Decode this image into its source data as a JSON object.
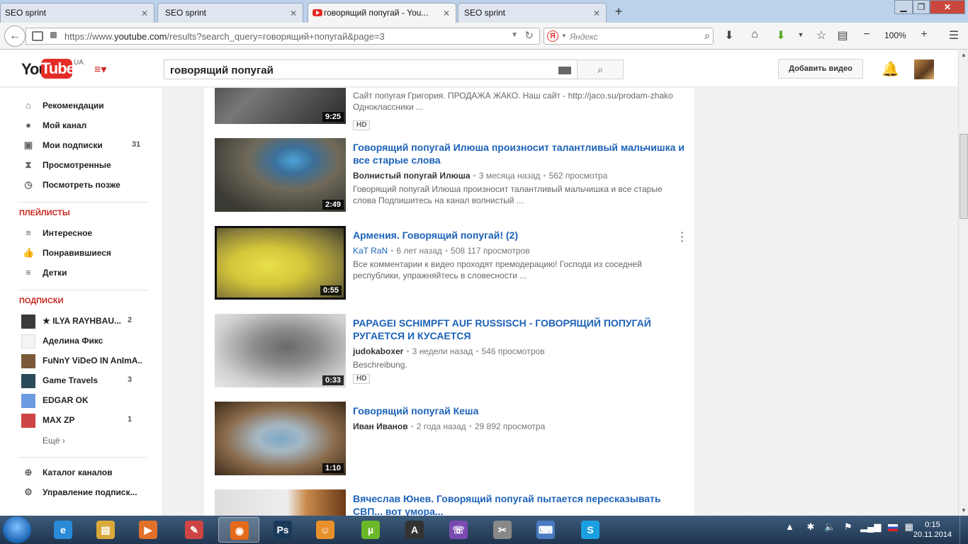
{
  "browser": {
    "tabs": [
      {
        "label": "SEO sprint",
        "active": false
      },
      {
        "label": "SEO sprint",
        "active": false
      },
      {
        "label": "говорящий попугай - You...",
        "active": true
      },
      {
        "label": "SEO sprint",
        "active": false
      }
    ],
    "new_tab_label": "+",
    "url_prefix": "https://www.",
    "url_domain": "youtube.com",
    "url_rest": "/results?search_query=говорящий+попугай&page=3",
    "search_placeholder": "Яндекс",
    "search_engine_glyph": "Я",
    "zoom": "100%"
  },
  "youtube": {
    "logo_you": "You",
    "logo_tube": "Tube",
    "region": "UA",
    "search_query": "говорящий попугай",
    "upload_label": "Добавить видео"
  },
  "sidebar": {
    "main_items": [
      {
        "label": "Рекомендации",
        "icon": "home-icon",
        "glyph": "⌂"
      },
      {
        "label": "Мой канал",
        "icon": "user-icon",
        "glyph": "●"
      },
      {
        "label": "Мои подписки",
        "icon": "subscriptions-icon",
        "glyph": "▣",
        "count": "31"
      },
      {
        "label": "Просмотренные",
        "icon": "history-icon",
        "glyph": "⧗"
      },
      {
        "label": "Посмотреть позже",
        "icon": "clock-icon",
        "glyph": "◷"
      }
    ],
    "playlists_heading": "ПЛЕЙЛИСТЫ",
    "playlists": [
      {
        "label": "Интересное",
        "icon": "list-icon",
        "glyph": "≡"
      },
      {
        "label": "Понравившиеся",
        "icon": "thumb-up-icon",
        "glyph": "👍"
      },
      {
        "label": "Детки",
        "icon": "list-icon",
        "glyph": "≡"
      }
    ],
    "subscriptions_heading": "ПОДПИСКИ",
    "subscriptions": [
      {
        "label": "★ ILYA RAYHBAU...",
        "count": "2",
        "color": "#3a3a3a"
      },
      {
        "label": "Аделина Фикс",
        "count": "",
        "color": "#f4f4f4"
      },
      {
        "label": "FuNnY ViDeO IN AnImA...",
        "count": "",
        "color": "#7a5a38"
      },
      {
        "label": "Game Travels",
        "count": "3",
        "color": "#2b4a5a"
      },
      {
        "label": "EDGAR OK",
        "count": "",
        "color": "#6d9be2"
      },
      {
        "label": "MAX ZP",
        "count": "1",
        "color": "#c44"
      }
    ],
    "more_label": "Ещё ›",
    "footer_items": [
      {
        "label": "Каталог каналов",
        "icon": "plus-circle-icon",
        "glyph": "⊕"
      },
      {
        "label": "Управление подписк...",
        "icon": "gear-icon",
        "glyph": "⚙"
      }
    ]
  },
  "results": [
    {
      "title": "",
      "channel": "",
      "age": "",
      "views": "",
      "desc": [
        "Сайт попугая Григория. ПРОДАЖА ЖАКО. Наш сайт - http://jaco.su/prodam-zhako",
        "Одноклассники ..."
      ],
      "duration": "9:25",
      "hd": "HD",
      "thumb_bg": "linear-gradient(135deg,#3a3a3a,#777 40%,#2a2a2a)"
    },
    {
      "title": "Говорящий попугай Илюша произносит талантливый мальчишка и все старые слова",
      "channel": "Волнистый попугай Илюша",
      "age": "3 месяца назад",
      "views": "562 просмотра",
      "desc": [
        "Говорящий попугай Илюша произносит талантливый мальчишка и все старые",
        "слова Подпишитесь на канал волнистый ..."
      ],
      "duration": "2:49",
      "hd": "",
      "thumb_bg": "radial-gradient(ellipse at 60% 30%,#4da3d8 0,#3b6f9a 18%,#6f6a5a 40%,#3c3a34 80%)"
    },
    {
      "title": "Армения. Говорящий попугай! (2)",
      "channel": "KaT RaN",
      "age": "6 лет назад",
      "views": "508 117 просмотров",
      "desc": [
        "Все комментарии к видео проходят премодерацию! Господа из соседней",
        "республики, упражняйтесь в словесности ..."
      ],
      "duration": "0:55",
      "hd": "",
      "thumb_bg": "radial-gradient(ellipse at 40% 55%,#e8e04a 0,#d4c53a 35%,#8a7f3a 70%,#3a3a2a 100%)"
    },
    {
      "title": "PAPAGEI SCHIMPFT AUF RUSSISCH - ГОВОРЯЩИЙ ПОПУГАЙ РУГАЕТСЯ И КУСАЕТСЯ",
      "channel": "judokaboxer",
      "age": "3 недели назад",
      "views": "546 просмотров",
      "desc": [
        "Beschreibung."
      ],
      "duration": "0:33",
      "hd": "HD",
      "thumb_bg": "radial-gradient(ellipse at 55% 45%,#6a6a6a 0,#8a8a8a 30%,#cfcfcf 70%,#e8e8e8 100%)"
    },
    {
      "title": "Говорящий попугай Кеша",
      "channel": "Иван Иванов",
      "age": "2 года назад",
      "views": "29 892 просмотра",
      "desc": [],
      "duration": "1:10",
      "hd": "",
      "thumb_bg": "radial-gradient(ellipse at 50% 50%,#7ea8c8 0,#a6b8c4 25%,#8a6a4a 60%,#3a2a1a 100%)"
    },
    {
      "title": "Вячеслав Юнев. Говорящий попугай пытается пересказывать СВП... вот умора...",
      "channel": "",
      "age": "",
      "views": "",
      "desc": [],
      "duration": "",
      "hd": "",
      "thumb_bg": "linear-gradient(90deg,#ddd 0,#eee 55%,#c9894a 70%,#6a3a1a 100%)"
    }
  ],
  "taskbar": {
    "apps": [
      {
        "name": "ie-icon",
        "glyph": "e",
        "color": "#2a8ad8"
      },
      {
        "name": "explorer-icon",
        "glyph": "▤",
        "color": "#d9a93a"
      },
      {
        "name": "media-player-icon",
        "glyph": "▶",
        "color": "#e0702a"
      },
      {
        "name": "paint-icon",
        "glyph": "✎",
        "color": "#c44"
      },
      {
        "name": "firefox-icon",
        "glyph": "◉",
        "color": "#e66a1a"
      },
      {
        "name": "photoshop-icon",
        "glyph": "Ps",
        "color": "#1b3a5a"
      },
      {
        "name": "ok-icon",
        "glyph": "☺",
        "color": "#e8902a"
      },
      {
        "name": "utorrent-icon",
        "glyph": "µ",
        "color": "#6ab82a"
      },
      {
        "name": "aimp-icon",
        "glyph": "A",
        "color": "#333"
      },
      {
        "name": "viber-icon",
        "glyph": "☏",
        "color": "#7a4ab0"
      },
      {
        "name": "tools-icon",
        "glyph": "✂",
        "color": "#888"
      },
      {
        "name": "keyboard-icon",
        "glyph": "⌨",
        "color": "#4a7ac0"
      },
      {
        "name": "skype-icon",
        "glyph": "S",
        "color": "#1aa0e0"
      }
    ],
    "active_app": 4,
    "time": "0:15",
    "date": "20.11.2014"
  }
}
